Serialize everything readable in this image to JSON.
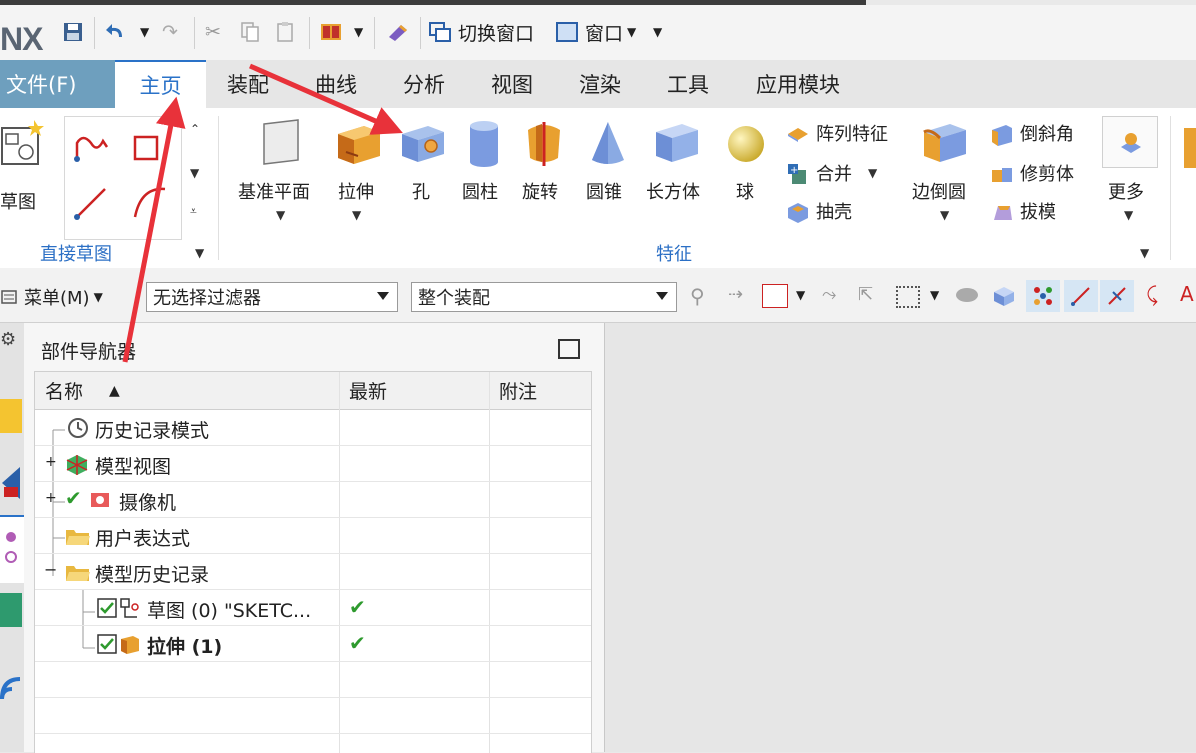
{
  "qat": {
    "logo": "NX",
    "switch_window": "切换窗口",
    "window": "窗口"
  },
  "tabs": [
    "文件(F)",
    "主页",
    "装配",
    "曲线",
    "分析",
    "视图",
    "渲染",
    "工具",
    "应用模块"
  ],
  "ribbon": {
    "sketch_label": "草图",
    "direct_sketch_group": "直接草图",
    "datum_plane": "基准平面",
    "extrude": "拉伸",
    "hole": "孔",
    "cylinder": "圆柱",
    "revolve": "旋转",
    "cone": "圆锥",
    "block": "长方体",
    "sphere": "球",
    "pattern_feature": "阵列特征",
    "unite": "合并",
    "shell": "抽壳",
    "edge_blend": "边倒圆",
    "chamfer": "倒斜角",
    "trim_body": "修剪体",
    "draft": "拔模",
    "more": "更多",
    "feature_group": "特征"
  },
  "selbar": {
    "menu": "菜单(M)",
    "filter": "无选择过滤器",
    "scope": "整个装配"
  },
  "navigator": {
    "title": "部件导航器",
    "columns": [
      "名称",
      "最新",
      "附注"
    ],
    "rows": [
      {
        "label": "历史记录模式",
        "latest": ""
      },
      {
        "label": "模型视图",
        "latest": ""
      },
      {
        "label": "摄像机",
        "latest": ""
      },
      {
        "label": "用户表达式",
        "latest": ""
      },
      {
        "label": "模型历史记录",
        "latest": ""
      },
      {
        "label": "草图 (0) \"SKETC...",
        "latest": "✔"
      },
      {
        "label": "拉伸 (1)",
        "latest": "✔"
      }
    ]
  },
  "colors": {
    "file_tab": "#6e9fbe",
    "accent": "#2a72c8",
    "arrow": "#e8323a",
    "check": "#2e9a2e"
  }
}
